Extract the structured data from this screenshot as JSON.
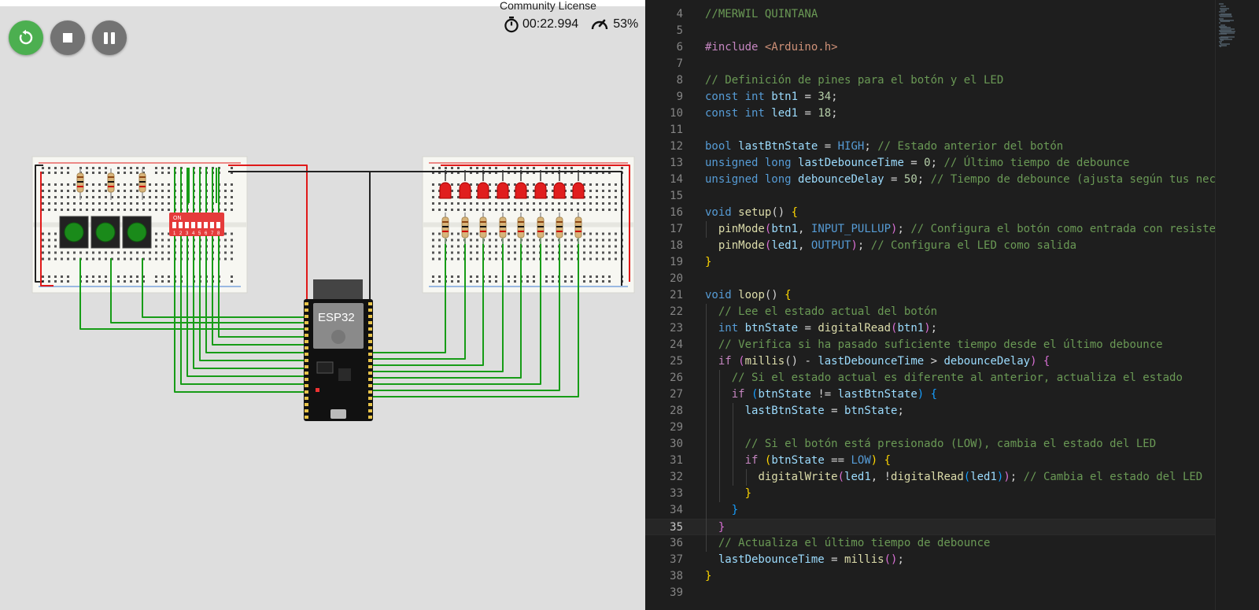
{
  "simulator": {
    "license_text": "Community License",
    "timer": "00:22.994",
    "speed": "53%",
    "controls": {
      "restart": "restart-icon",
      "stop": "stop-icon",
      "pause": "pause-icon"
    },
    "board_label": "ESP32",
    "dip_label": "ON",
    "dip_numbers": [
      "1",
      "2",
      "3",
      "4",
      "5",
      "6",
      "7",
      "8"
    ],
    "colors": {
      "restart": "#4caf50",
      "control": "#737373",
      "wire_green": "#179c17",
      "wire_red": "#e01919",
      "wire_black": "#222222",
      "led_red": "#e01e1e",
      "button_green": "#1a8a1a",
      "dip_red": "#e53b3b"
    }
  },
  "editor": {
    "current_line": "35",
    "lines": [
      {
        "n": "4",
        "tokens": [
          {
            "t": "//MERWIL QUINTANA",
            "c": "cm"
          }
        ]
      },
      {
        "n": "5",
        "tokens": []
      },
      {
        "n": "6",
        "tokens": [
          {
            "t": "#include ",
            "c": "pp"
          },
          {
            "t": "<Arduino.h>",
            "c": "str"
          }
        ]
      },
      {
        "n": "7",
        "tokens": []
      },
      {
        "n": "8",
        "tokens": [
          {
            "t": "// Definición de pines para el botón y el LED",
            "c": "cm"
          }
        ]
      },
      {
        "n": "9",
        "tokens": [
          {
            "t": "const int ",
            "c": "kw"
          },
          {
            "t": "btn1",
            "c": "var"
          },
          {
            "t": " = ",
            "c": "txt"
          },
          {
            "t": "34",
            "c": "num"
          },
          {
            "t": ";",
            "c": "txt"
          }
        ]
      },
      {
        "n": "10",
        "tokens": [
          {
            "t": "const int ",
            "c": "kw"
          },
          {
            "t": "led1",
            "c": "var"
          },
          {
            "t": " = ",
            "c": "txt"
          },
          {
            "t": "18",
            "c": "num"
          },
          {
            "t": ";",
            "c": "txt"
          }
        ]
      },
      {
        "n": "11",
        "tokens": []
      },
      {
        "n": "12",
        "tokens": [
          {
            "t": "bool ",
            "c": "kw"
          },
          {
            "t": "lastBtnState",
            "c": "var"
          },
          {
            "t": " = ",
            "c": "txt"
          },
          {
            "t": "HIGH",
            "c": "kw"
          },
          {
            "t": "; ",
            "c": "txt"
          },
          {
            "t": "// Estado anterior del botón",
            "c": "cm"
          }
        ]
      },
      {
        "n": "13",
        "tokens": [
          {
            "t": "unsigned long ",
            "c": "kw"
          },
          {
            "t": "lastDebounceTime",
            "c": "var"
          },
          {
            "t": " = ",
            "c": "txt"
          },
          {
            "t": "0",
            "c": "num"
          },
          {
            "t": "; ",
            "c": "txt"
          },
          {
            "t": "// Último tiempo de debounce",
            "c": "cm"
          }
        ]
      },
      {
        "n": "14",
        "tokens": [
          {
            "t": "unsigned long ",
            "c": "kw"
          },
          {
            "t": "debounceDelay",
            "c": "var"
          },
          {
            "t": " = ",
            "c": "txt"
          },
          {
            "t": "50",
            "c": "num"
          },
          {
            "t": "; ",
            "c": "txt"
          },
          {
            "t": "// Tiempo de debounce (ajusta según tus nec",
            "c": "cm"
          }
        ]
      },
      {
        "n": "15",
        "tokens": []
      },
      {
        "n": "16",
        "tokens": [
          {
            "t": "void ",
            "c": "kw"
          },
          {
            "t": "setup",
            "c": "fn"
          },
          {
            "t": "() ",
            "c": "txt"
          },
          {
            "t": "{",
            "c": "b1"
          }
        ]
      },
      {
        "n": "17",
        "tokens": [
          {
            "t": "  ",
            "c": "txt"
          },
          {
            "t": "pinMode",
            "c": "fn"
          },
          {
            "t": "(",
            "c": "b2"
          },
          {
            "t": "btn1",
            "c": "var"
          },
          {
            "t": ", ",
            "c": "txt"
          },
          {
            "t": "INPUT_PULLUP",
            "c": "kw"
          },
          {
            "t": ")",
            "c": "b2"
          },
          {
            "t": "; ",
            "c": "txt"
          },
          {
            "t": "// Configura el botón como entrada con resiste",
            "c": "cm"
          }
        ]
      },
      {
        "n": "18",
        "tokens": [
          {
            "t": "  ",
            "c": "txt"
          },
          {
            "t": "pinMode",
            "c": "fn"
          },
          {
            "t": "(",
            "c": "b2"
          },
          {
            "t": "led1",
            "c": "var"
          },
          {
            "t": ", ",
            "c": "txt"
          },
          {
            "t": "OUTPUT",
            "c": "kw"
          },
          {
            "t": ")",
            "c": "b2"
          },
          {
            "t": "; ",
            "c": "txt"
          },
          {
            "t": "// Configura el LED como salida",
            "c": "cm"
          }
        ]
      },
      {
        "n": "19",
        "tokens": [
          {
            "t": "}",
            "c": "b1"
          }
        ]
      },
      {
        "n": "20",
        "tokens": []
      },
      {
        "n": "21",
        "tokens": [
          {
            "t": "void ",
            "c": "kw"
          },
          {
            "t": "loop",
            "c": "fn"
          },
          {
            "t": "() ",
            "c": "txt"
          },
          {
            "t": "{",
            "c": "b1"
          }
        ]
      },
      {
        "n": "22",
        "tokens": [
          {
            "t": "  ",
            "c": "txt"
          },
          {
            "t": "// Lee el estado actual del botón",
            "c": "cm"
          }
        ]
      },
      {
        "n": "23",
        "tokens": [
          {
            "t": "  ",
            "c": "txt"
          },
          {
            "t": "int ",
            "c": "kw"
          },
          {
            "t": "btnState",
            "c": "var"
          },
          {
            "t": " = ",
            "c": "txt"
          },
          {
            "t": "digitalRead",
            "c": "fn"
          },
          {
            "t": "(",
            "c": "b2"
          },
          {
            "t": "btn1",
            "c": "var"
          },
          {
            "t": ")",
            "c": "b2"
          },
          {
            "t": ";",
            "c": "txt"
          }
        ]
      },
      {
        "n": "24",
        "tokens": [
          {
            "t": "  ",
            "c": "txt"
          },
          {
            "t": "// Verifica si ha pasado suficiente tiempo desde el último debounce",
            "c": "cm"
          }
        ]
      },
      {
        "n": "25",
        "tokens": [
          {
            "t": "  ",
            "c": "txt"
          },
          {
            "t": "if ",
            "c": "pp"
          },
          {
            "t": "(",
            "c": "b2"
          },
          {
            "t": "millis",
            "c": "fn"
          },
          {
            "t": "() - ",
            "c": "txt"
          },
          {
            "t": "lastDebounceTime",
            "c": "var"
          },
          {
            "t": " > ",
            "c": "txt"
          },
          {
            "t": "debounceDelay",
            "c": "var"
          },
          {
            "t": ") ",
            "c": "b2"
          },
          {
            "t": "{",
            "c": "b2"
          }
        ]
      },
      {
        "n": "26",
        "tokens": [
          {
            "t": "    ",
            "c": "txt"
          },
          {
            "t": "// Si el estado actual es diferente al anterior, actualiza el estado",
            "c": "cm"
          }
        ]
      },
      {
        "n": "27",
        "tokens": [
          {
            "t": "    ",
            "c": "txt"
          },
          {
            "t": "if ",
            "c": "pp"
          },
          {
            "t": "(",
            "c": "b3"
          },
          {
            "t": "btnState",
            "c": "var"
          },
          {
            "t": " != ",
            "c": "txt"
          },
          {
            "t": "lastBtnState",
            "c": "var"
          },
          {
            "t": ") ",
            "c": "b3"
          },
          {
            "t": "{",
            "c": "b3"
          }
        ]
      },
      {
        "n": "28",
        "tokens": [
          {
            "t": "      ",
            "c": "txt"
          },
          {
            "t": "lastBtnState",
            "c": "var"
          },
          {
            "t": " = ",
            "c": "txt"
          },
          {
            "t": "btnState",
            "c": "var"
          },
          {
            "t": ";",
            "c": "txt"
          }
        ]
      },
      {
        "n": "29",
        "tokens": []
      },
      {
        "n": "30",
        "tokens": [
          {
            "t": "      ",
            "c": "txt"
          },
          {
            "t": "// Si el botón está presionado (LOW), cambia el estado del LED",
            "c": "cm"
          }
        ]
      },
      {
        "n": "31",
        "tokens": [
          {
            "t": "      ",
            "c": "txt"
          },
          {
            "t": "if ",
            "c": "pp"
          },
          {
            "t": "(",
            "c": "b1"
          },
          {
            "t": "btnState",
            "c": "var"
          },
          {
            "t": " == ",
            "c": "txt"
          },
          {
            "t": "LOW",
            "c": "kw"
          },
          {
            "t": ") ",
            "c": "b1"
          },
          {
            "t": "{",
            "c": "b1"
          }
        ]
      },
      {
        "n": "32",
        "tokens": [
          {
            "t": "        ",
            "c": "txt"
          },
          {
            "t": "digitalWrite",
            "c": "fn"
          },
          {
            "t": "(",
            "c": "b2"
          },
          {
            "t": "led1",
            "c": "var"
          },
          {
            "t": ", !",
            "c": "txt"
          },
          {
            "t": "digitalRead",
            "c": "fn"
          },
          {
            "t": "(",
            "c": "b3"
          },
          {
            "t": "led1",
            "c": "var"
          },
          {
            "t": ")",
            "c": "b3"
          },
          {
            "t": ")",
            "c": "b2"
          },
          {
            "t": "; ",
            "c": "txt"
          },
          {
            "t": "// Cambia el estado del LED",
            "c": "cm"
          }
        ]
      },
      {
        "n": "33",
        "tokens": [
          {
            "t": "      ",
            "c": "txt"
          },
          {
            "t": "}",
            "c": "b1"
          }
        ]
      },
      {
        "n": "34",
        "tokens": [
          {
            "t": "    ",
            "c": "txt"
          },
          {
            "t": "}",
            "c": "b3"
          }
        ]
      },
      {
        "n": "35",
        "tokens": [
          {
            "t": "  ",
            "c": "txt"
          },
          {
            "t": "}",
            "c": "b2"
          }
        ]
      },
      {
        "n": "36",
        "tokens": [
          {
            "t": "  ",
            "c": "txt"
          },
          {
            "t": "// Actualiza el último tiempo de debounce",
            "c": "cm"
          }
        ]
      },
      {
        "n": "37",
        "tokens": [
          {
            "t": "  ",
            "c": "txt"
          },
          {
            "t": "lastDebounceTime",
            "c": "var"
          },
          {
            "t": " = ",
            "c": "txt"
          },
          {
            "t": "millis",
            "c": "fn"
          },
          {
            "t": "()",
            "c": "b2"
          },
          {
            "t": ";",
            "c": "txt"
          }
        ]
      },
      {
        "n": "38",
        "tokens": [
          {
            "t": "}",
            "c": "b1"
          }
        ]
      },
      {
        "n": "39",
        "tokens": []
      }
    ]
  }
}
